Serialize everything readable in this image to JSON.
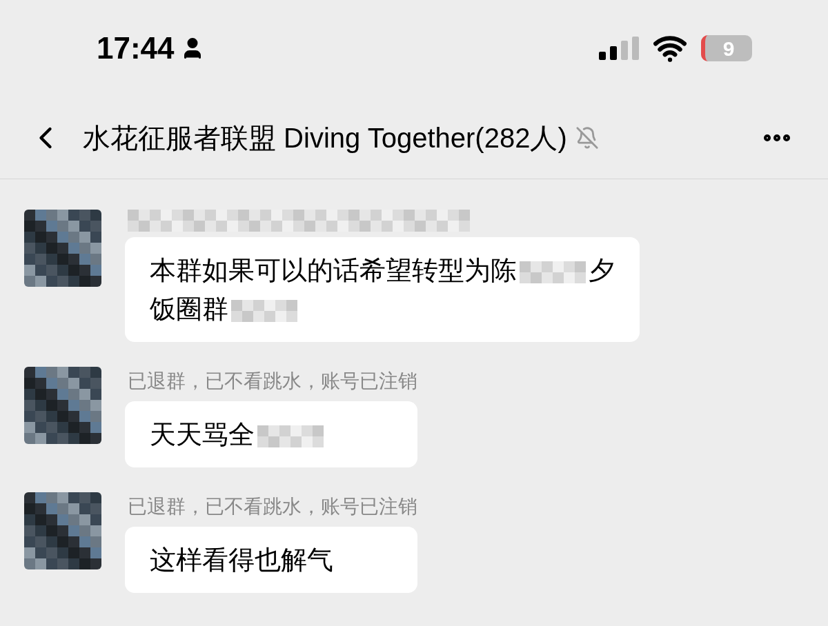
{
  "status_bar": {
    "time": "17:44",
    "battery": "9"
  },
  "header": {
    "title": "水花征服者联盟 Diving Together(282人)",
    "muted": true
  },
  "messages": [
    {
      "lines": [
        [
          {
            "kind": "text",
            "text": "本群如果可以的话希望转型为陈"
          },
          {
            "kind": "mosaic"
          },
          {
            "kind": "text",
            "text": "夕"
          }
        ],
        [
          {
            "kind": "text",
            "text": "饭圈群"
          },
          {
            "kind": "mosaic"
          }
        ]
      ]
    },
    {
      "sender": "已退群，已不看跳水，账号已注销",
      "lines": [
        [
          {
            "kind": "text",
            "text": "天天骂全"
          },
          {
            "kind": "mosaic"
          }
        ]
      ]
    },
    {
      "sender": "已退群，已不看跳水，账号已注销",
      "lines": [
        [
          {
            "kind": "text",
            "text": "这样看得也解气"
          }
        ]
      ]
    }
  ]
}
